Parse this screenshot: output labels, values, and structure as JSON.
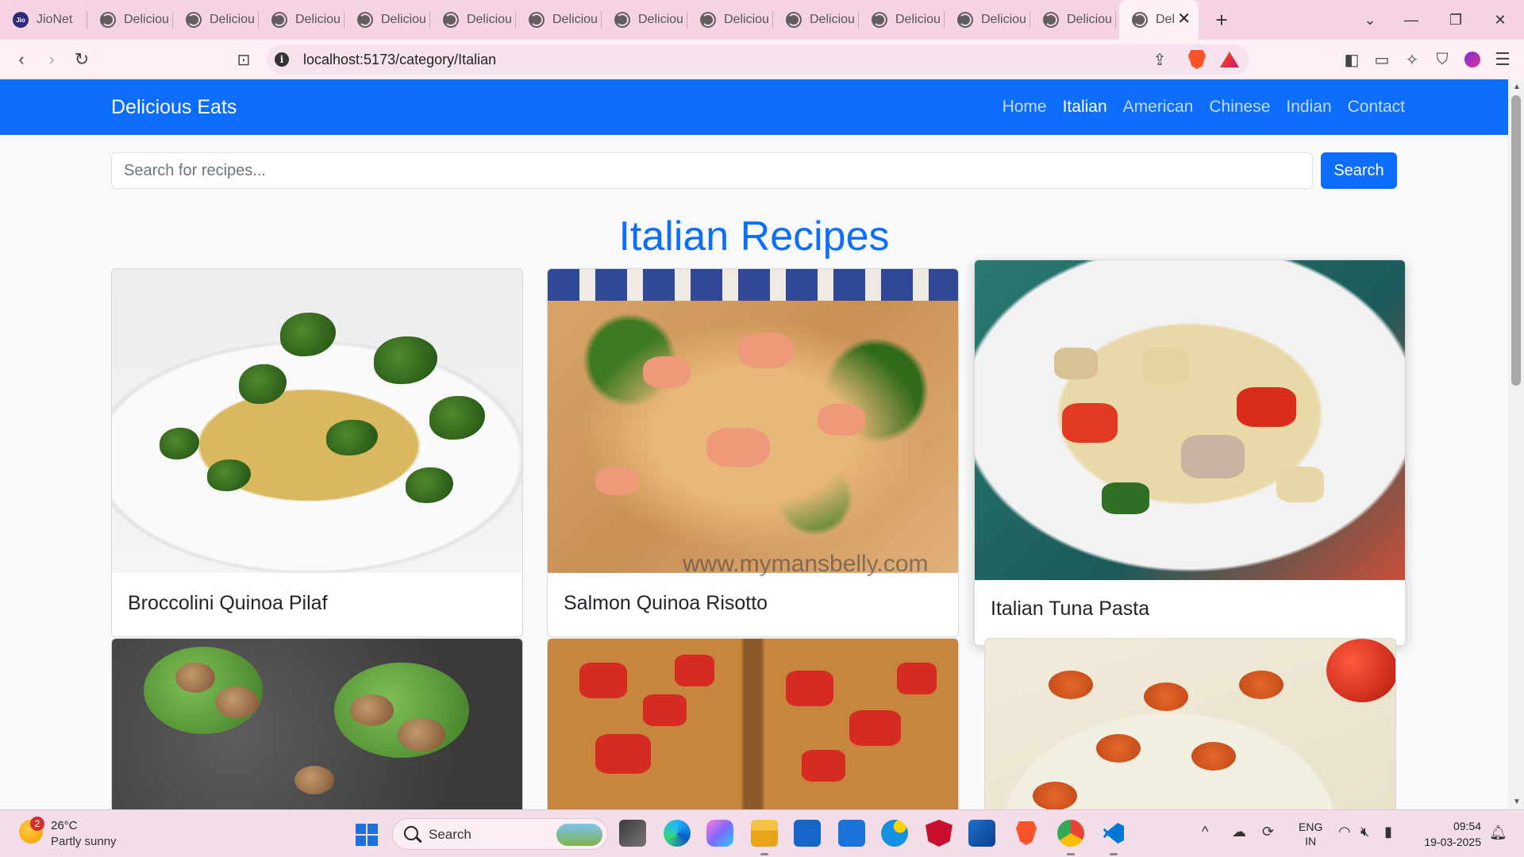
{
  "browser": {
    "tabs": [
      {
        "label": "JioNet",
        "icon": "jio-icon"
      },
      {
        "label": "Delicious Eats",
        "icon": "globe-icon"
      },
      {
        "label": "Delicious Eats",
        "icon": "globe-icon"
      },
      {
        "label": "Delicious Eats",
        "icon": "globe-icon"
      },
      {
        "label": "Delicious Eats",
        "icon": "globe-icon"
      },
      {
        "label": "Delicious Eats",
        "icon": "globe-icon"
      },
      {
        "label": "Delicious Eats",
        "icon": "globe-icon"
      },
      {
        "label": "Delicious Eats",
        "icon": "globe-icon"
      },
      {
        "label": "Delicious Eats",
        "icon": "globe-icon"
      },
      {
        "label": "Delicious Eats",
        "icon": "globe-icon"
      },
      {
        "label": "Delicious Eats",
        "icon": "globe-icon"
      },
      {
        "label": "Delicious Eats",
        "icon": "globe-icon"
      },
      {
        "label": "Delicious Eats",
        "icon": "globe-icon"
      }
    ],
    "active_tab": {
      "label": "Delicious Eats",
      "icon": "globe-icon"
    },
    "new_tab_symbol": "+",
    "url": "localhost:5173/category/Italian"
  },
  "site": {
    "brand": "Delicious Eats",
    "nav": [
      "Home",
      "Italian",
      "American",
      "Chinese",
      "Indian",
      "Contact"
    ],
    "active_nav": "Italian",
    "search": {
      "placeholder": "Search for recipes...",
      "button": "Search"
    },
    "heading": "Italian Recipes",
    "recipes": [
      {
        "title": "Broccolini Quinoa Pilaf"
      },
      {
        "title": "Salmon Quinoa Risotto",
        "watermark": "www.mymansbelly.com"
      },
      {
        "title": "Italian Tuna Pasta"
      },
      {
        "title": ""
      },
      {
        "title": ""
      },
      {
        "title": ""
      }
    ]
  },
  "taskbar": {
    "weather": {
      "temp": "26°C",
      "desc": "Partly sunny",
      "badge": "2"
    },
    "search_label": "Search",
    "lang": [
      "ENG",
      "IN"
    ],
    "time": "09:54",
    "date": "19-03-2025"
  },
  "colors": {
    "primary": "#0d6efd",
    "tabstrip": "#f6d3e3"
  }
}
